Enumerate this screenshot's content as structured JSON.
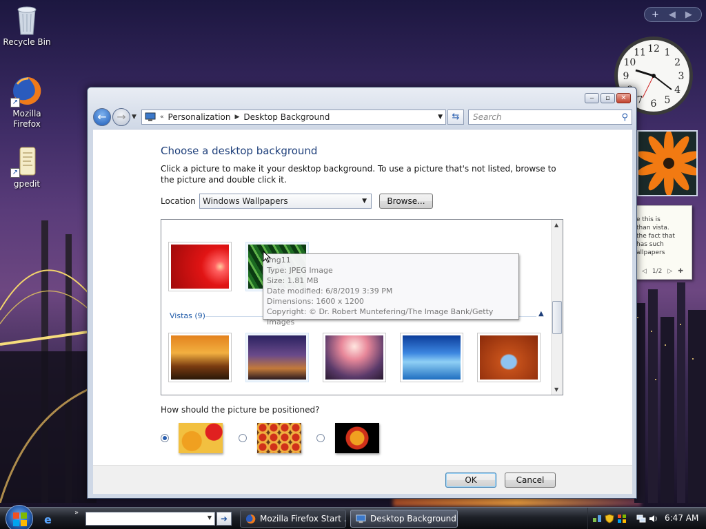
{
  "desktop": {
    "icons": [
      {
        "label": "Recycle Bin"
      },
      {
        "label": "Mozilla Firefox"
      },
      {
        "label": "gpedit"
      }
    ]
  },
  "gadgets": {
    "notes_lines": [
      "e this is",
      "than vista.",
      "the fact that",
      "has such",
      "allpapers"
    ],
    "notes_page": "1/2",
    "clock_numerals": [
      "12",
      "1",
      "2",
      "3",
      "4",
      "5",
      "6",
      "7",
      "8",
      "9",
      "10",
      "11"
    ]
  },
  "window": {
    "breadcrumb": [
      "Personalization",
      "Desktop Background"
    ],
    "search_placeholder": "Search",
    "heading": "Choose a desktop background",
    "description": "Click a picture to make it your desktop background. To use a picture that's not listed, browse to the picture and double click it.",
    "location_label": "Location",
    "location_value": "Windows Wallpapers",
    "browse_label": "Browse...",
    "group_header": "Vistas (9)",
    "tooltip": {
      "name": "img11",
      "type": "Type: JPEG Image",
      "size": "Size: 1.81 MB",
      "modified": "Date modified: 6/8/2019 3:39 PM",
      "dimensions": "Dimensions: 1600 x 1200",
      "copyright": "Copyright: © Dr. Robert Muntefering/The Image Bank/Getty Images"
    },
    "position_question": "How should the picture be positioned?",
    "ok_label": "OK",
    "cancel_label": "Cancel"
  },
  "taskbar": {
    "tasks": [
      "Mozilla Firefox Start ...",
      "Desktop Background"
    ],
    "time": "6:47 AM"
  },
  "colors": {
    "accent": "#1e3f7a",
    "link": "#1e5aa8"
  }
}
